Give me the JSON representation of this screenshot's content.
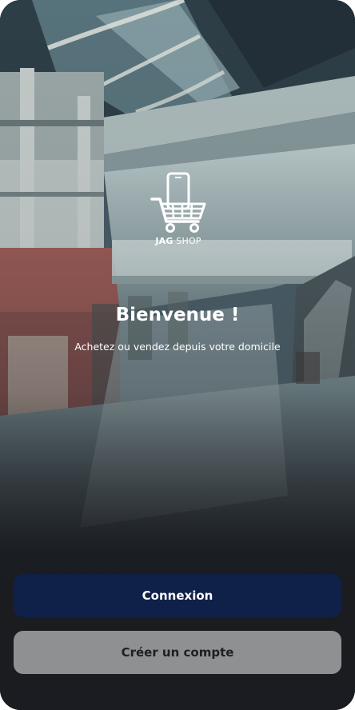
{
  "app": {
    "brand_bold": "JAG",
    "brand_rest": " SHOP",
    "logo_icon": "shopping-cart-phone-icon"
  },
  "welcome": {
    "title": "Bienvenue !",
    "subtitle": "Achetez ou vendez depuis votre domicile"
  },
  "actions": {
    "login_label": "Connexion",
    "signup_label": "Créer un compte"
  },
  "colors": {
    "primary_button": "#0f2148",
    "secondary_button": "#8e9092",
    "background_dark": "#1a1c21",
    "text_light": "#ffffff"
  },
  "background_image": "shopping-mall-photo"
}
